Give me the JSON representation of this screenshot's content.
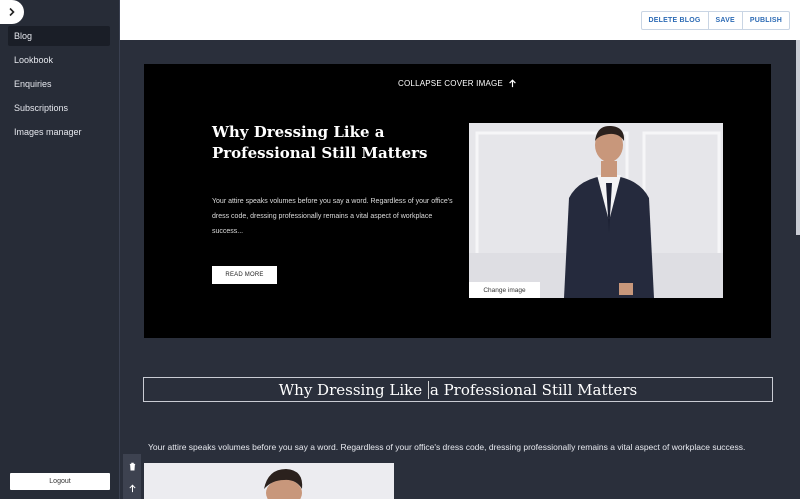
{
  "sidebar": {
    "toggle_icon": "chevron-right-icon",
    "items": [
      {
        "label": "Blog"
      },
      {
        "label": "Lookbook"
      },
      {
        "label": "Enquiries"
      },
      {
        "label": "Subscriptions"
      },
      {
        "label": "Images manager"
      }
    ],
    "logout_label": "Logout"
  },
  "toolbar": {
    "delete_label": "DELETE BLOG",
    "save_label": "SAVE",
    "publish_label": "PUBLISH"
  },
  "cover": {
    "collapse_label": "COLLAPSE COVER IMAGE",
    "collapse_icon": "arrow-up-icon",
    "title": "Why Dressing Like a Professional Still Matters",
    "excerpt": "Your attire speaks volumes before you say a word. Regardless of your office's dress code, dressing professionally remains a vital aspect of workplace success...",
    "read_more_label": "READ MORE",
    "change_image_label": "Change image"
  },
  "editor": {
    "title_before_caret": "Why Dressing Like ",
    "title_after_caret": "a Professional Still Matters",
    "paragraph": "Your attire speaks volumes before you say a word. Regardless of your office's dress code, dressing professionally remains a vital aspect of workplace success."
  },
  "colors": {
    "background": "#2a2f3b",
    "sidebar": "#272c37",
    "accent": "#2d6bb5",
    "cover": "#000000"
  }
}
